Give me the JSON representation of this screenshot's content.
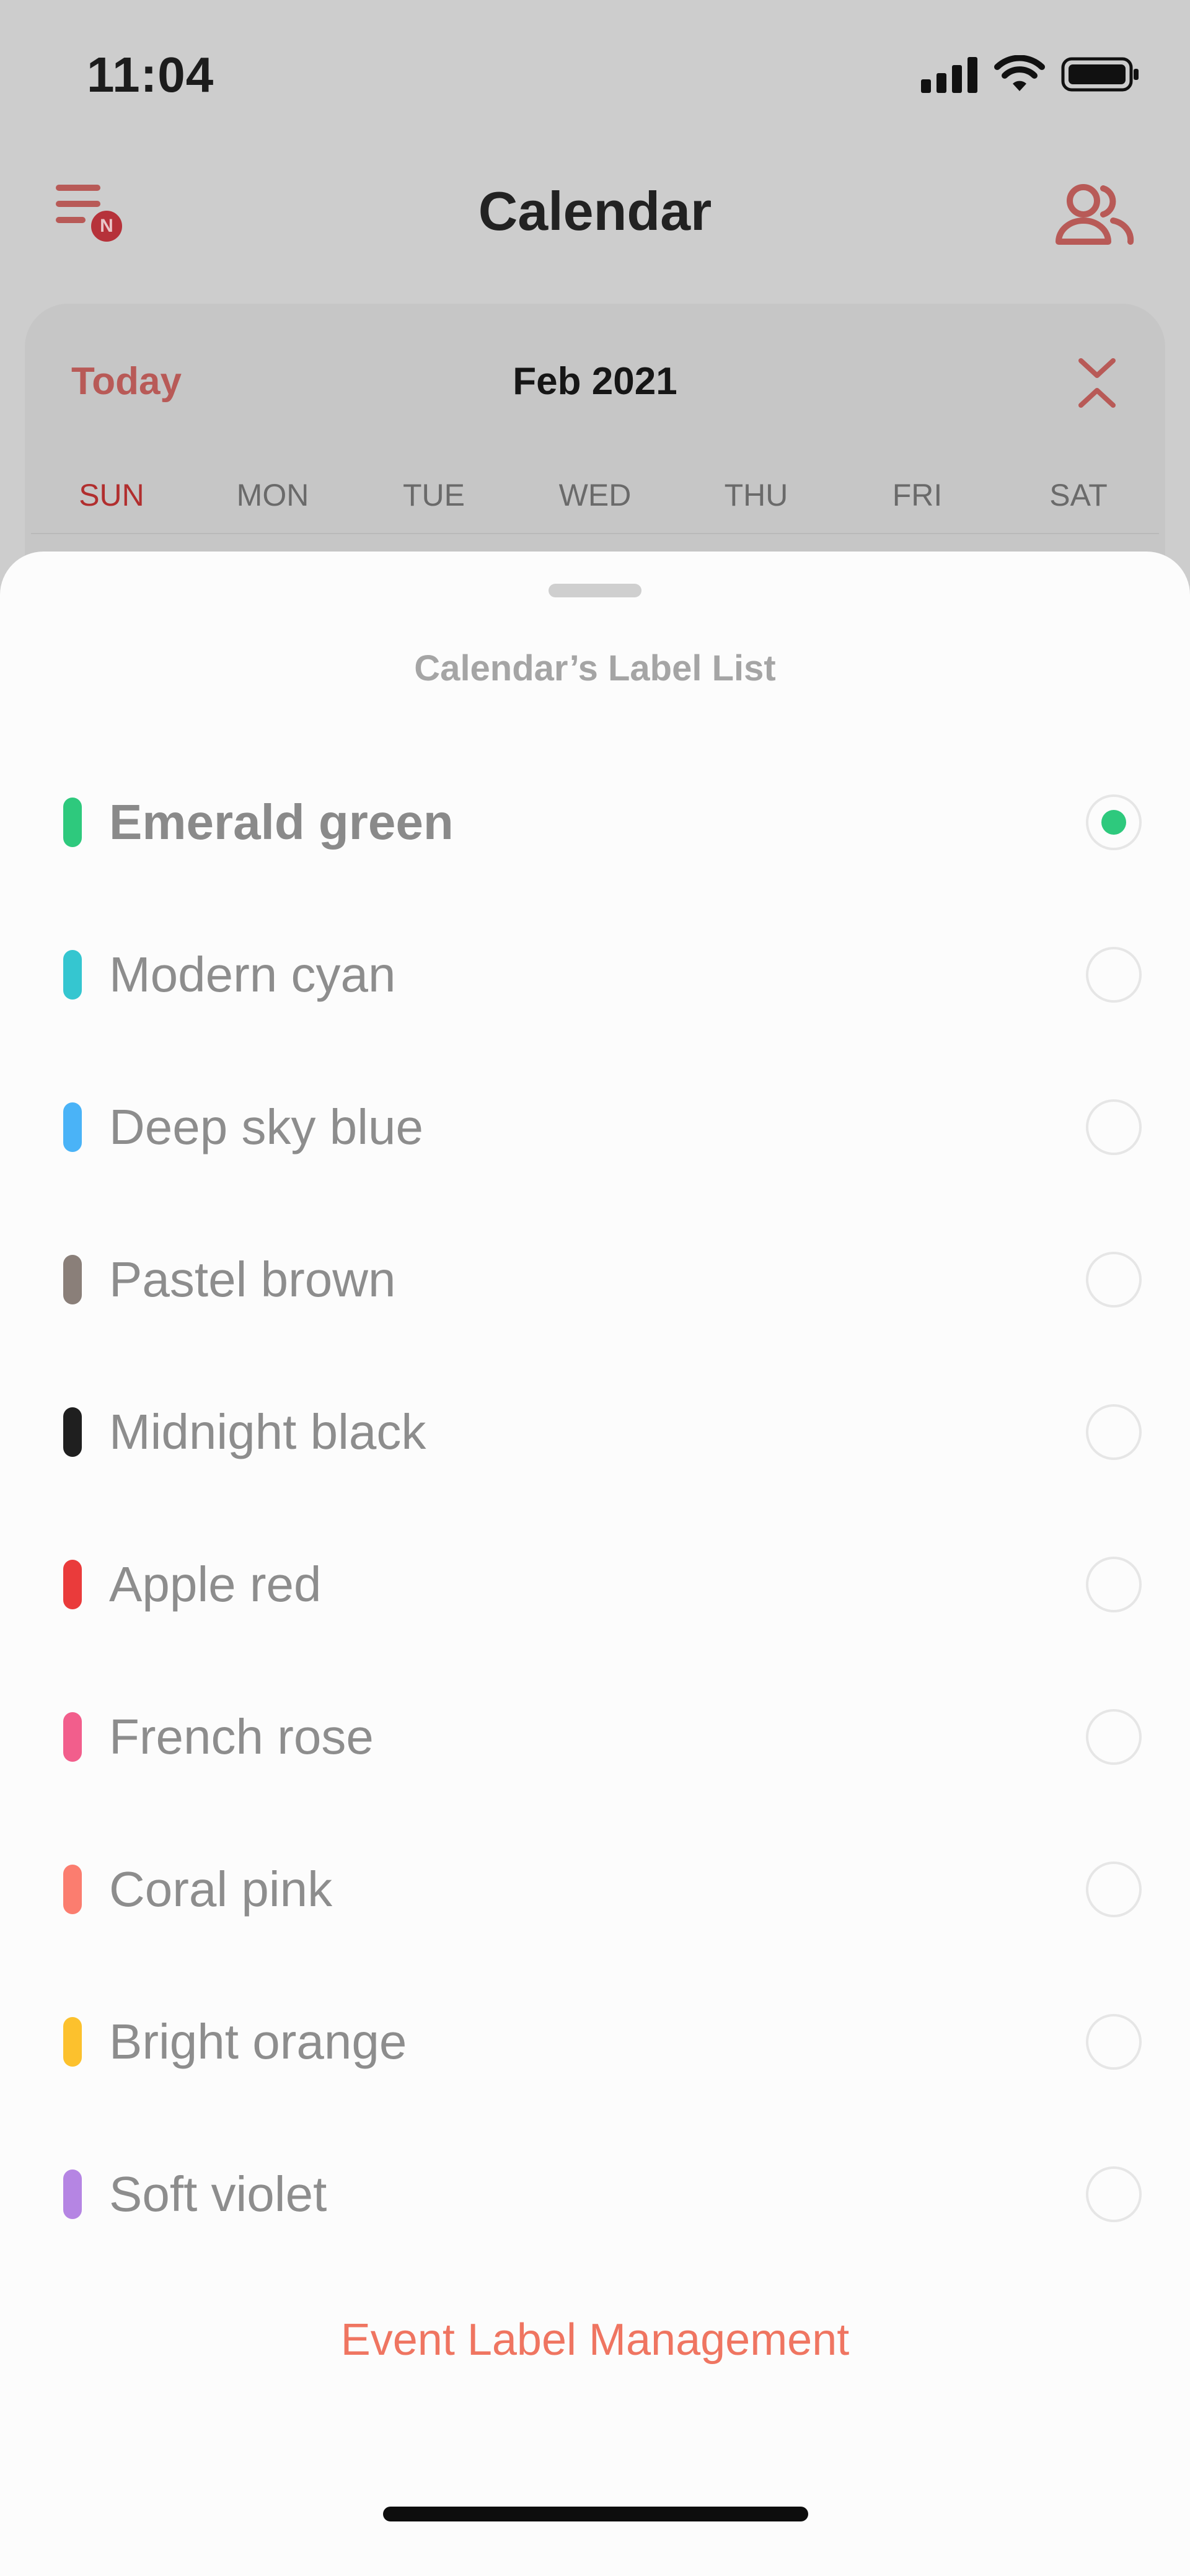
{
  "status_bar": {
    "time": "11:04"
  },
  "nav": {
    "title": "Calendar",
    "menu_badge": "N",
    "accent_color": "#e45f57"
  },
  "calendar": {
    "today_label": "Today",
    "month_label": "Feb 2021",
    "weekdays": [
      "SUN",
      "MON",
      "TUE",
      "WED",
      "THU",
      "FRI",
      "SAT"
    ]
  },
  "sheet": {
    "title": "Calendar’s Label List",
    "labels": [
      {
        "name": "Emerald green",
        "color": "#2ec97d",
        "selected": true
      },
      {
        "name": "Modern cyan",
        "color": "#35c6d0",
        "selected": false
      },
      {
        "name": "Deep sky blue",
        "color": "#4ab3f7",
        "selected": false
      },
      {
        "name": "Pastel brown",
        "color": "#8a7f79",
        "selected": false
      },
      {
        "name": "Midnight black",
        "color": "#1f1f1f",
        "selected": false
      },
      {
        "name": "Apple red",
        "color": "#ea3b3b",
        "selected": false
      },
      {
        "name": "French rose",
        "color": "#f25e8c",
        "selected": false
      },
      {
        "name": "Coral pink",
        "color": "#fb7d6f",
        "selected": false
      },
      {
        "name": "Bright orange",
        "color": "#fcc12d",
        "selected": false
      },
      {
        "name": "Soft violet",
        "color": "#b585e3",
        "selected": false
      }
    ],
    "manage_link": "Event Label Management",
    "manage_link_color": "#ef7561"
  }
}
